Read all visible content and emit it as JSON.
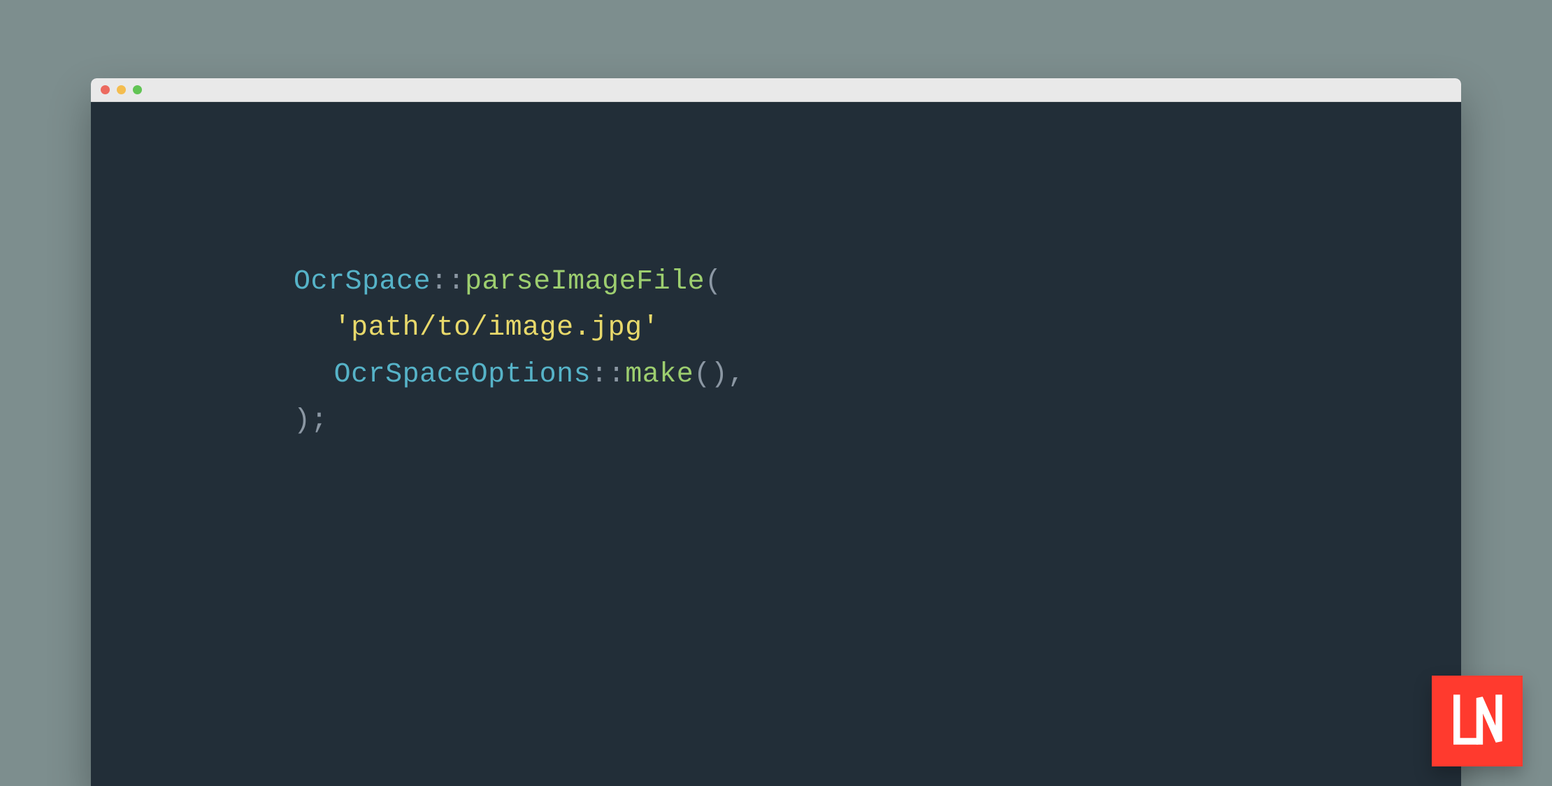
{
  "colors": {
    "page_bg": "#7d8e8e",
    "editor_bg": "#222e38",
    "titlebar_bg": "#e9e9e9",
    "token_class": "#56b3c8",
    "token_method": "#9dce6f",
    "token_string": "#e8d96b",
    "token_punc": "#8b97a3",
    "logo_bg": "#ff3a2e"
  },
  "titlebar": {
    "traffic_lights": [
      "close",
      "minimize",
      "maximize"
    ]
  },
  "code": {
    "line1": {
      "class1": "OcrSpace",
      "scope1": "::",
      "method1": "parseImageFile",
      "paren_open": "("
    },
    "line2": {
      "string": "'path/to/image.jpg'"
    },
    "line3": {
      "class2": "OcrSpaceOptions",
      "scope2": "::",
      "method2": "make",
      "call": "(),"
    },
    "line4": {
      "close": ");"
    }
  },
  "logo": {
    "label": "LN"
  }
}
